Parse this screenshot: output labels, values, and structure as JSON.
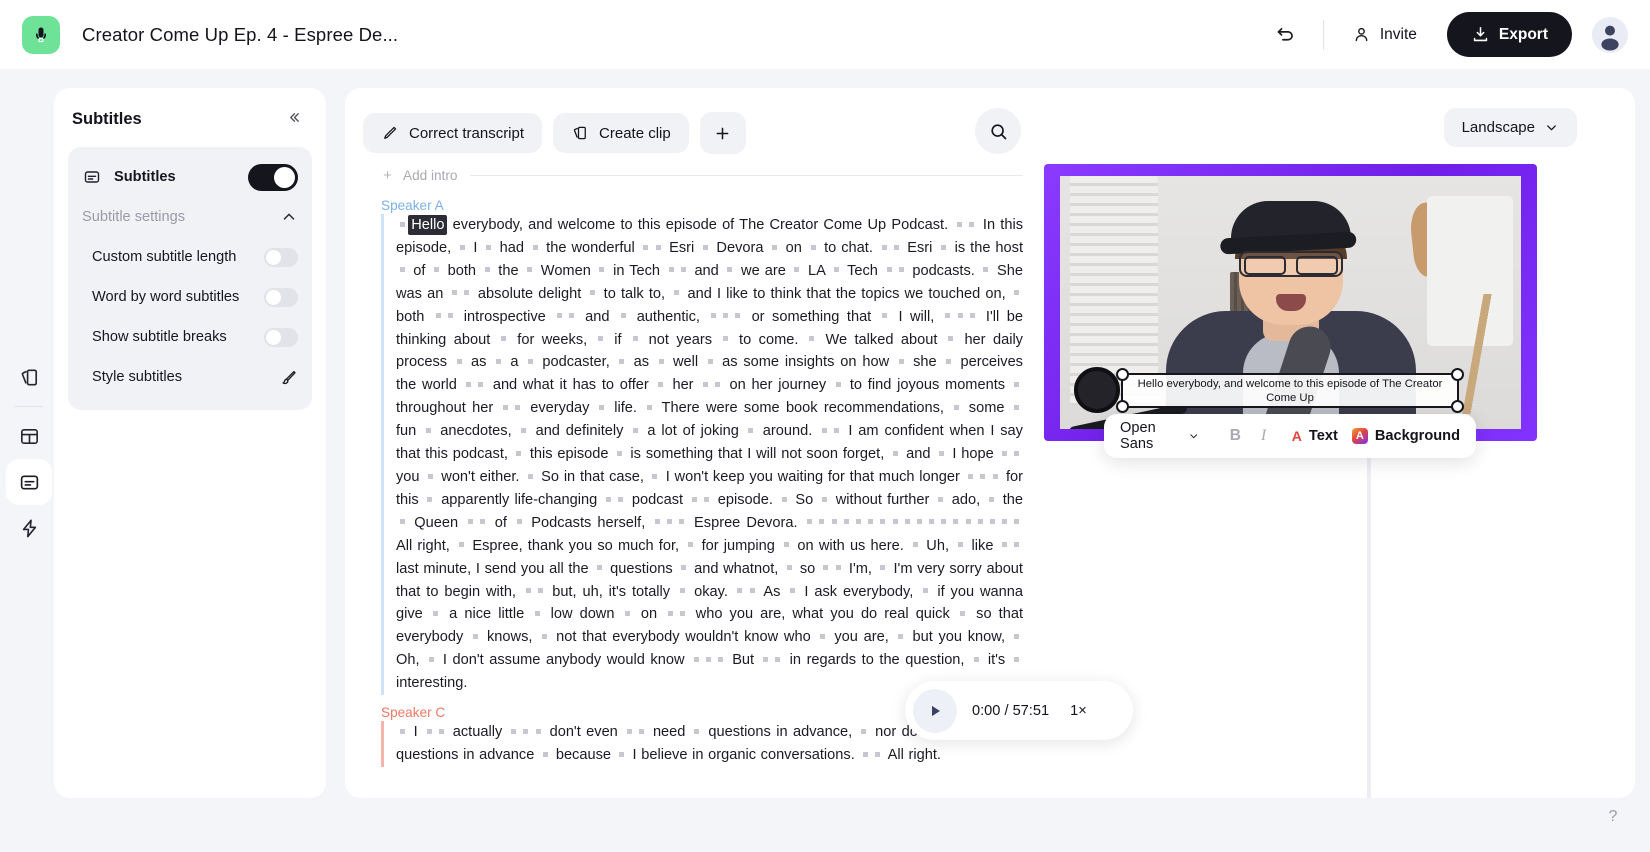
{
  "header": {
    "doc_title": "Creator Come Up Ep. 4 - Espree De...",
    "logo_icon": "microphone-icon",
    "undo_icon": "undo-arrow-icon",
    "invite_label": "Invite",
    "invite_icon": "person-icon",
    "export_label": "Export",
    "export_icon": "download-icon",
    "avatar_icon": "user-avatar-icon"
  },
  "rail": {
    "items": [
      {
        "name": "clips",
        "icon": "cards-stack-icon",
        "active": false
      },
      {
        "name": "layout",
        "icon": "layout-grid-icon",
        "active": false
      },
      {
        "name": "subtitles",
        "icon": "subtitles-icon",
        "active": true
      },
      {
        "name": "magic",
        "icon": "lightning-bolt-icon",
        "active": false
      }
    ]
  },
  "panel": {
    "title": "Subtitles",
    "collapse_icon": "chevron-double-left-icon",
    "subtitles_row": {
      "label": "Subtitles",
      "icon": "subtitles-icon",
      "toggle_on": true
    },
    "settings_header": {
      "label": "Subtitle settings",
      "chevron_icon": "chevron-up-icon"
    },
    "settings": [
      {
        "label": "Custom subtitle length",
        "toggle_on": false
      },
      {
        "label": "Word by word subtitles",
        "toggle_on": false
      },
      {
        "label": "Show subtitle breaks",
        "toggle_on": false
      }
    ],
    "style_row": {
      "label": "Style subtitles",
      "icon": "paintbrush-icon"
    }
  },
  "toolbar": {
    "correct_transcript": "Correct transcript",
    "correct_icon": "pencil-icon",
    "create_clip": "Create clip",
    "create_clip_icon": "cards-stack-icon",
    "add_icon": "plus-icon",
    "search_icon": "search-icon",
    "ratio_label": "Landscape",
    "ratio_chevron": "chevron-down-icon"
  },
  "transcript": {
    "add_intro_label": "Add intro",
    "add_intro_icon": "plus-icon",
    "blocks": [
      {
        "speaker": "Speaker A",
        "speaker_color": "#7bb1e8",
        "highlight_word": "Hello",
        "text": "everybody, and welcome to this episode of The Creator Come Up Podcast. ▪▪ In this episode, ▪ I ▪ had ▪ the wonderful ▪▪ Esri ▪ Devora ▪ on ▪ to chat. ▪▪ Esri ▪ is the host ▪ of ▪ both ▪ the ▪ Women ▪ in Tech ▪▪ and ▪ we are ▪ LA ▪ Tech ▪▪ podcasts. ▪ She was an ▪▪ absolute delight ▪ to talk to, ▪ and I like to think that the topics we touched on, ▪ both ▪▪ introspective ▪▪ and ▪ authentic, ▪▪▪ or something that ▪ I will, ▪▪▪ I'll be thinking about ▪ for weeks, ▪ if ▪ not years ▪ to come. ▪ We talked about ▪ her daily process ▪ as ▪ a ▪ podcaster, ▪ as ▪ well ▪ as some insights on how ▪ she ▪ perceives the world ▪▪ and what it has to offer ▪ her ▪▪ on her journey ▪ to find joyous moments ▪ throughout her ▪▪ everyday ▪ life. ▪ There were some book recommendations, ▪ some ▪ fun ▪ anecdotes, ▪ and definitely ▪ a lot of joking ▪ around. ▪▪ I am confident when I say that this podcast, ▪ this episode ▪ is something that I will not soon forget, ▪ and ▪ I hope ▪▪ you ▪ won't either. ▪ So in that case, ▪ I won't keep you waiting for that much longer ▪▪▪ for this ▪ apparently life-changing ▪▪ podcast ▪▪ episode. ▪ So ▪ without further ▪ ado, ▪ the ▪ Queen ▪▪ of ▪ Podcasts herself, ▪▪▪ Espree Devora. ▪▪▪▪▪▪▪▪▪▪▪▪▪▪▪▪▪▪ All right, ▪ Espree, thank you so much for, ▪ for jumping ▪ on with us here. ▪ Uh, ▪ like ▪▪ last minute, I send you all the ▪ questions ▪ and whatnot, ▪ so ▪▪ I'm, ▪ I'm very sorry about that to begin with, ▪▪ but, uh, it's totally ▪ okay. ▪▪ As ▪ I ask everybody, ▪ if you wanna give ▪ a nice little ▪ low down ▪ on ▪▪ who you are, what you do real quick ▪ so that everybody ▪ knows, ▪ not that everybody wouldn't know who ▪ you are, ▪ but you know, ▪ Oh, ▪ I don't assume anybody would know ▪▪▪ But ▪▪ in regards to the question, ▪ it's ▪ interesting."
      },
      {
        "speaker": "Speaker C",
        "speaker_color": "#ee7a66",
        "highlight_word": "",
        "text": "▪ I ▪▪ actually ▪▪▪ don't even ▪▪ need ▪ questions in advance, ▪ nor do I send guest ▪ questions in advance ▪ because ▪ I believe in organic conversations. ▪▪ All right."
      }
    ]
  },
  "preview": {
    "frame_color": "#7b2ff7",
    "subtitle_text": "Hello everybody, and welcome to this episode of The Creator Come Up",
    "subtitle_text_line2": "Up",
    "handles": [
      "top-left",
      "top-right",
      "bottom-left",
      "bottom-right"
    ]
  },
  "format_bar": {
    "font_name": "Open Sans",
    "font_chevron": "chevron-down-icon",
    "bold_label": "B",
    "italic_label": "I",
    "text_label": "Text",
    "text_icon": "letter-a-color-icon",
    "background_label": "Background",
    "background_icon": "letter-a-gradient-icon"
  },
  "player": {
    "play_icon": "play-triangle-icon",
    "current_time": "0:00",
    "separator": "/",
    "total_time": "57:51",
    "time_display": "0:00 / 57:51",
    "speed": "1×"
  },
  "help": {
    "icon": "question-mark-icon",
    "label": "?"
  }
}
